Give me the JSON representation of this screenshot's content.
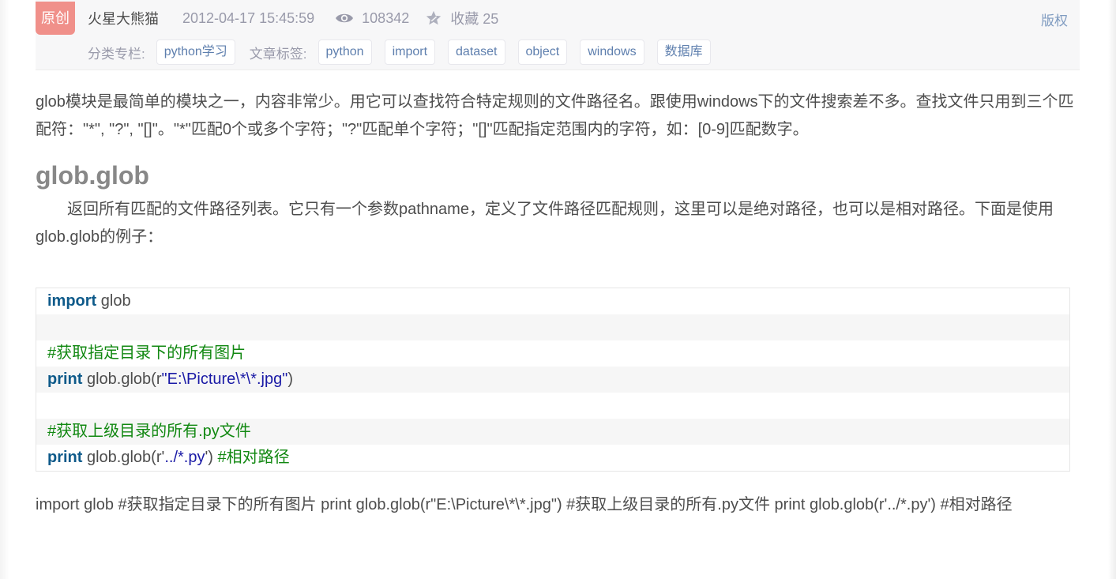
{
  "meta": {
    "badge": "原创",
    "author": "火星大熊猫",
    "date": "2012-04-17 15:45:59",
    "views": "108342",
    "collect": "收藏 25",
    "copyright": "版权",
    "category_label": "分类专栏:",
    "categories": [
      "python学习"
    ],
    "tags_label": "文章标签:",
    "tags": [
      "python",
      "import",
      "dataset",
      "object",
      "windows",
      "数据库"
    ]
  },
  "article": {
    "intro": "glob模块是最简单的模块之一，内容非常少。用它可以查找符合特定规则的文件路径名。跟使用windows下的文件搜索差不多。查找文件只用到三个匹配符：\"*\", \"?\", \"[]\"。\"*\"匹配0个或多个字符；\"?\"匹配单个字符；\"[]\"匹配指定范围内的字符，如：[0-9]匹配数字。",
    "heading": "glob.glob",
    "paragraph": "　　返回所有匹配的文件路径列表。它只有一个参数pathname，定义了文件路径匹配规则，这里可以是绝对路径，也可以是相对路径。下面是使用glob.glob的例子：",
    "plain_code": "import glob #获取指定目录下的所有图片 print glob.glob(r\"E:\\Picture\\*\\*.jpg\") #获取上级目录的所有.py文件 print glob.glob(r'../*.py') #相对路径"
  },
  "code": {
    "l1_kw": "import",
    "l1_rest": " glob",
    "l3_comment": "#获取指定目录下的所有图片",
    "l4_kw": "print",
    "l4_a": " glob.glob(r",
    "l4_str": "\"E:\\Picture\\*\\*.jpg\"",
    "l4_b": ")",
    "l6_comment": "#获取上级目录的所有.py文件",
    "l7_kw": "print",
    "l7_a": " glob.glob(r'",
    "l7_str": "../*.py",
    "l7_b": "') ",
    "l7_comment": "#相对路径"
  },
  "colors": {
    "badge": "#f0908a",
    "tag_text": "#5e7fae",
    "keyword": "#0e5a8a",
    "comment": "#118811",
    "string": "#1a1aa6"
  }
}
